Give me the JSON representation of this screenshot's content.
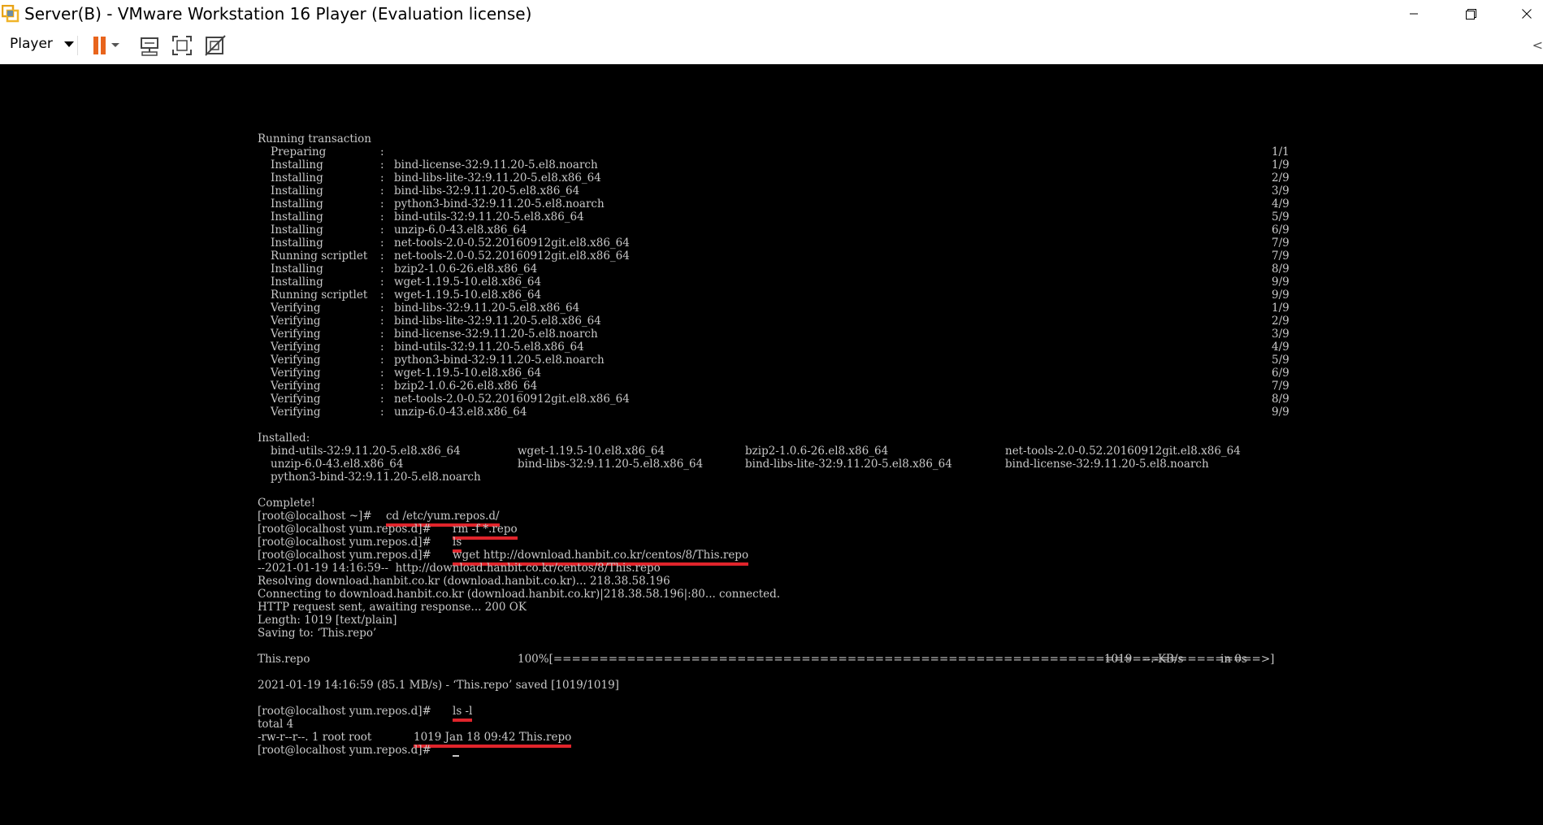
{
  "window": {
    "title": "Server(B) - VMware Workstation 16 Player (Evaluation license)",
    "app_icon": "vmware-icon",
    "controls": [
      "minimize-icon",
      "restore-icon",
      "close-icon"
    ]
  },
  "toolbar": {
    "player_label": "Player",
    "buttons": [
      "pause-icon",
      "send-ctrl-alt-del-icon",
      "full-screen-icon",
      "unity-icon"
    ],
    "collapse_icon": "collapse-left-icon"
  },
  "colors": {
    "highlight": "#e0242b",
    "terminal_text": "#c8c8c8",
    "terminal_bg": "#000000"
  },
  "terminal": {
    "transaction_header": "Running transaction",
    "transaction": [
      {
        "action": "Preparing",
        "package": "",
        "progress": "1/1"
      },
      {
        "action": "Installing",
        "package": "bind-license-32:9.11.20-5.el8.noarch",
        "progress": "1/9"
      },
      {
        "action": "Installing",
        "package": "bind-libs-lite-32:9.11.20-5.el8.x86_64",
        "progress": "2/9"
      },
      {
        "action": "Installing",
        "package": "bind-libs-32:9.11.20-5.el8.x86_64",
        "progress": "3/9"
      },
      {
        "action": "Installing",
        "package": "python3-bind-32:9.11.20-5.el8.noarch",
        "progress": "4/9"
      },
      {
        "action": "Installing",
        "package": "bind-utils-32:9.11.20-5.el8.x86_64",
        "progress": "5/9"
      },
      {
        "action": "Installing",
        "package": "unzip-6.0-43.el8.x86_64",
        "progress": "6/9"
      },
      {
        "action": "Installing",
        "package": "net-tools-2.0-0.52.20160912git.el8.x86_64",
        "progress": "7/9"
      },
      {
        "action": "Running scriptlet",
        "package": "net-tools-2.0-0.52.20160912git.el8.x86_64",
        "progress": "7/9"
      },
      {
        "action": "Installing",
        "package": "bzip2-1.0.6-26.el8.x86_64",
        "progress": "8/9"
      },
      {
        "action": "Installing",
        "package": "wget-1.19.5-10.el8.x86_64",
        "progress": "9/9"
      },
      {
        "action": "Running scriptlet",
        "package": "wget-1.19.5-10.el8.x86_64",
        "progress": "9/9"
      },
      {
        "action": "Verifying",
        "package": "bind-libs-32:9.11.20-5.el8.x86_64",
        "progress": "1/9"
      },
      {
        "action": "Verifying",
        "package": "bind-libs-lite-32:9.11.20-5.el8.x86_64",
        "progress": "2/9"
      },
      {
        "action": "Verifying",
        "package": "bind-license-32:9.11.20-5.el8.noarch",
        "progress": "3/9"
      },
      {
        "action": "Verifying",
        "package": "bind-utils-32:9.11.20-5.el8.x86_64",
        "progress": "4/9"
      },
      {
        "action": "Verifying",
        "package": "python3-bind-32:9.11.20-5.el8.noarch",
        "progress": "5/9"
      },
      {
        "action": "Verifying",
        "package": "wget-1.19.5-10.el8.x86_64",
        "progress": "6/9"
      },
      {
        "action": "Verifying",
        "package": "bzip2-1.0.6-26.el8.x86_64",
        "progress": "7/9"
      },
      {
        "action": "Verifying",
        "package": "net-tools-2.0-0.52.20160912git.el8.x86_64",
        "progress": "8/9"
      },
      {
        "action": "Verifying",
        "package": "unzip-6.0-43.el8.x86_64",
        "progress": "9/9"
      }
    ],
    "installed_header": "Installed:",
    "installed": [
      [
        "bind-utils-32:9.11.20-5.el8.x86_64",
        "wget-1.19.5-10.el8.x86_64",
        "bzip2-1.0.6-26.el8.x86_64",
        "net-tools-2.0-0.52.20160912git.el8.x86_64"
      ],
      [
        "unzip-6.0-43.el8.x86_64",
        "bind-libs-32:9.11.20-5.el8.x86_64",
        "bind-libs-lite-32:9.11.20-5.el8.x86_64",
        "bind-license-32:9.11.20-5.el8.noarch"
      ],
      [
        "python3-bind-32:9.11.20-5.el8.noarch",
        "",
        "",
        ""
      ]
    ],
    "complete": "Complete!",
    "prompt_home": "[root@localhost ~]#",
    "prompt_repos": "[root@localhost yum.repos.d]#",
    "cmd_cd": "cd /etc/yum.repos.d/",
    "cmd_rm": "rm -f *.repo",
    "cmd_ls": "ls",
    "cmd_wget": "wget http://download.hanbit.co.kr/centos/8/This.repo",
    "wget_output": [
      "--2021-01-19 14:16:59--  http://download.hanbit.co.kr/centos/8/This.repo",
      "Resolving download.hanbit.co.kr (download.hanbit.co.kr)... 218.38.58.196",
      "Connecting to download.hanbit.co.kr (download.hanbit.co.kr)|218.38.58.196|:80... connected.",
      "HTTP request sent, awaiting response... 200 OK",
      "Length: 1019 [text/plain]",
      "Saving to: ‘This.repo’"
    ],
    "progress": {
      "file": "This.repo",
      "bar": "100%[=============================================================================>]",
      "size": "1019",
      "rate": "--.-KB/s",
      "eta": "in 0s"
    },
    "saved_line": "2021-01-19 14:16:59 (85.1 MB/s) - ‘This.repo’ saved [1019/1019]",
    "cmd_lsl": "ls -l",
    "total_line": "total 4",
    "ls_perms": "-rw-r--r--. 1 root root",
    "ls_detail": "1019 Jan 18 09:42 This.repo"
  }
}
